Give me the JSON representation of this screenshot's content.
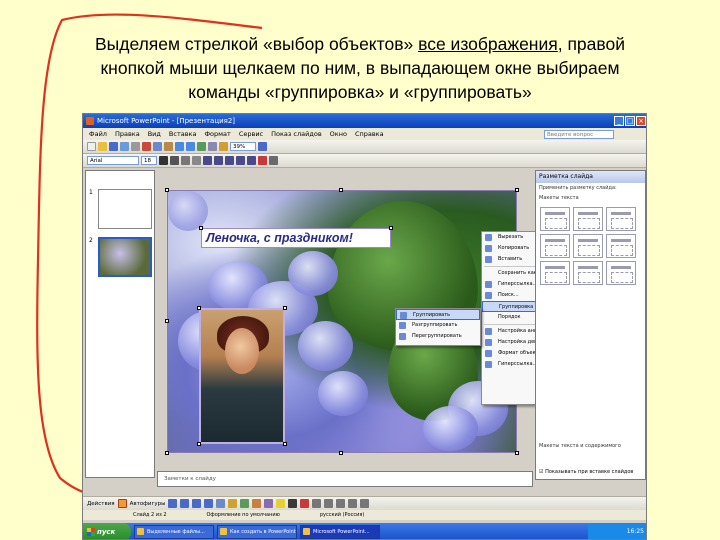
{
  "caption": {
    "line1_pre": "Выделяем стрелкой «выбор объектов» ",
    "line1_u": "все изображения",
    "line1_post": ", правой",
    "line2": "кнопкой мыши щелкаем по ним, в выпадающем окне выбираем",
    "line3": "команды «группировка» и «группировать»"
  },
  "colors": {
    "page_bg": "#ffffcc",
    "arrow_line": "#e03020",
    "xp_blue": "#1a4fc8"
  },
  "window": {
    "title": "Microsoft PowerPoint - [Презентация2]",
    "menu": [
      "Файл",
      "Правка",
      "Вид",
      "Вставка",
      "Формат",
      "Сервис",
      "Показ слайдов",
      "Окно",
      "Справка"
    ],
    "help_placeholder": "Введите вопрос",
    "zoom": "39%",
    "font": "Arial",
    "font_size": "18"
  },
  "slides_pane": {
    "thumbs": [
      "1",
      "2"
    ]
  },
  "slide": {
    "greeting": "Леночка, с праздником!"
  },
  "context_menu": {
    "items": [
      "Вырезать",
      "Копировать",
      "Вставить",
      "Сохранить как рисунок...",
      "Гиперссылка...",
      "Поиск...",
      "Группировка",
      "Порядок",
      "Настройка анимации...",
      "Настройка действия...",
      "Формат объекта...",
      "Гиперссылка..."
    ],
    "highlighted": "Группировка",
    "submenu": [
      "Группировать",
      "Разгруппировать",
      "Перегруппировать"
    ]
  },
  "task_pane": {
    "title": "Разметка слайда",
    "subtitle": "Применить разметку слайда:",
    "section": "Макеты текста",
    "section2": "Макеты текста и содержимого",
    "footer": "Показывать при вставке слайдов"
  },
  "notes": {
    "placeholder": "Заметки к слайду"
  },
  "draw_bar": {
    "actions": "Действия",
    "autoshapes": "Автофигуры"
  },
  "status": {
    "slide": "Слайд 2 из 2",
    "design": "Оформление по умолчанию",
    "lang": "русский (Россия)"
  },
  "taskbar": {
    "start": "пуск",
    "tasks": [
      "Выделенные файлы...",
      "Как создать в PowerPoint...",
      "Microsoft PowerPoint..."
    ],
    "clock": "16:25"
  }
}
